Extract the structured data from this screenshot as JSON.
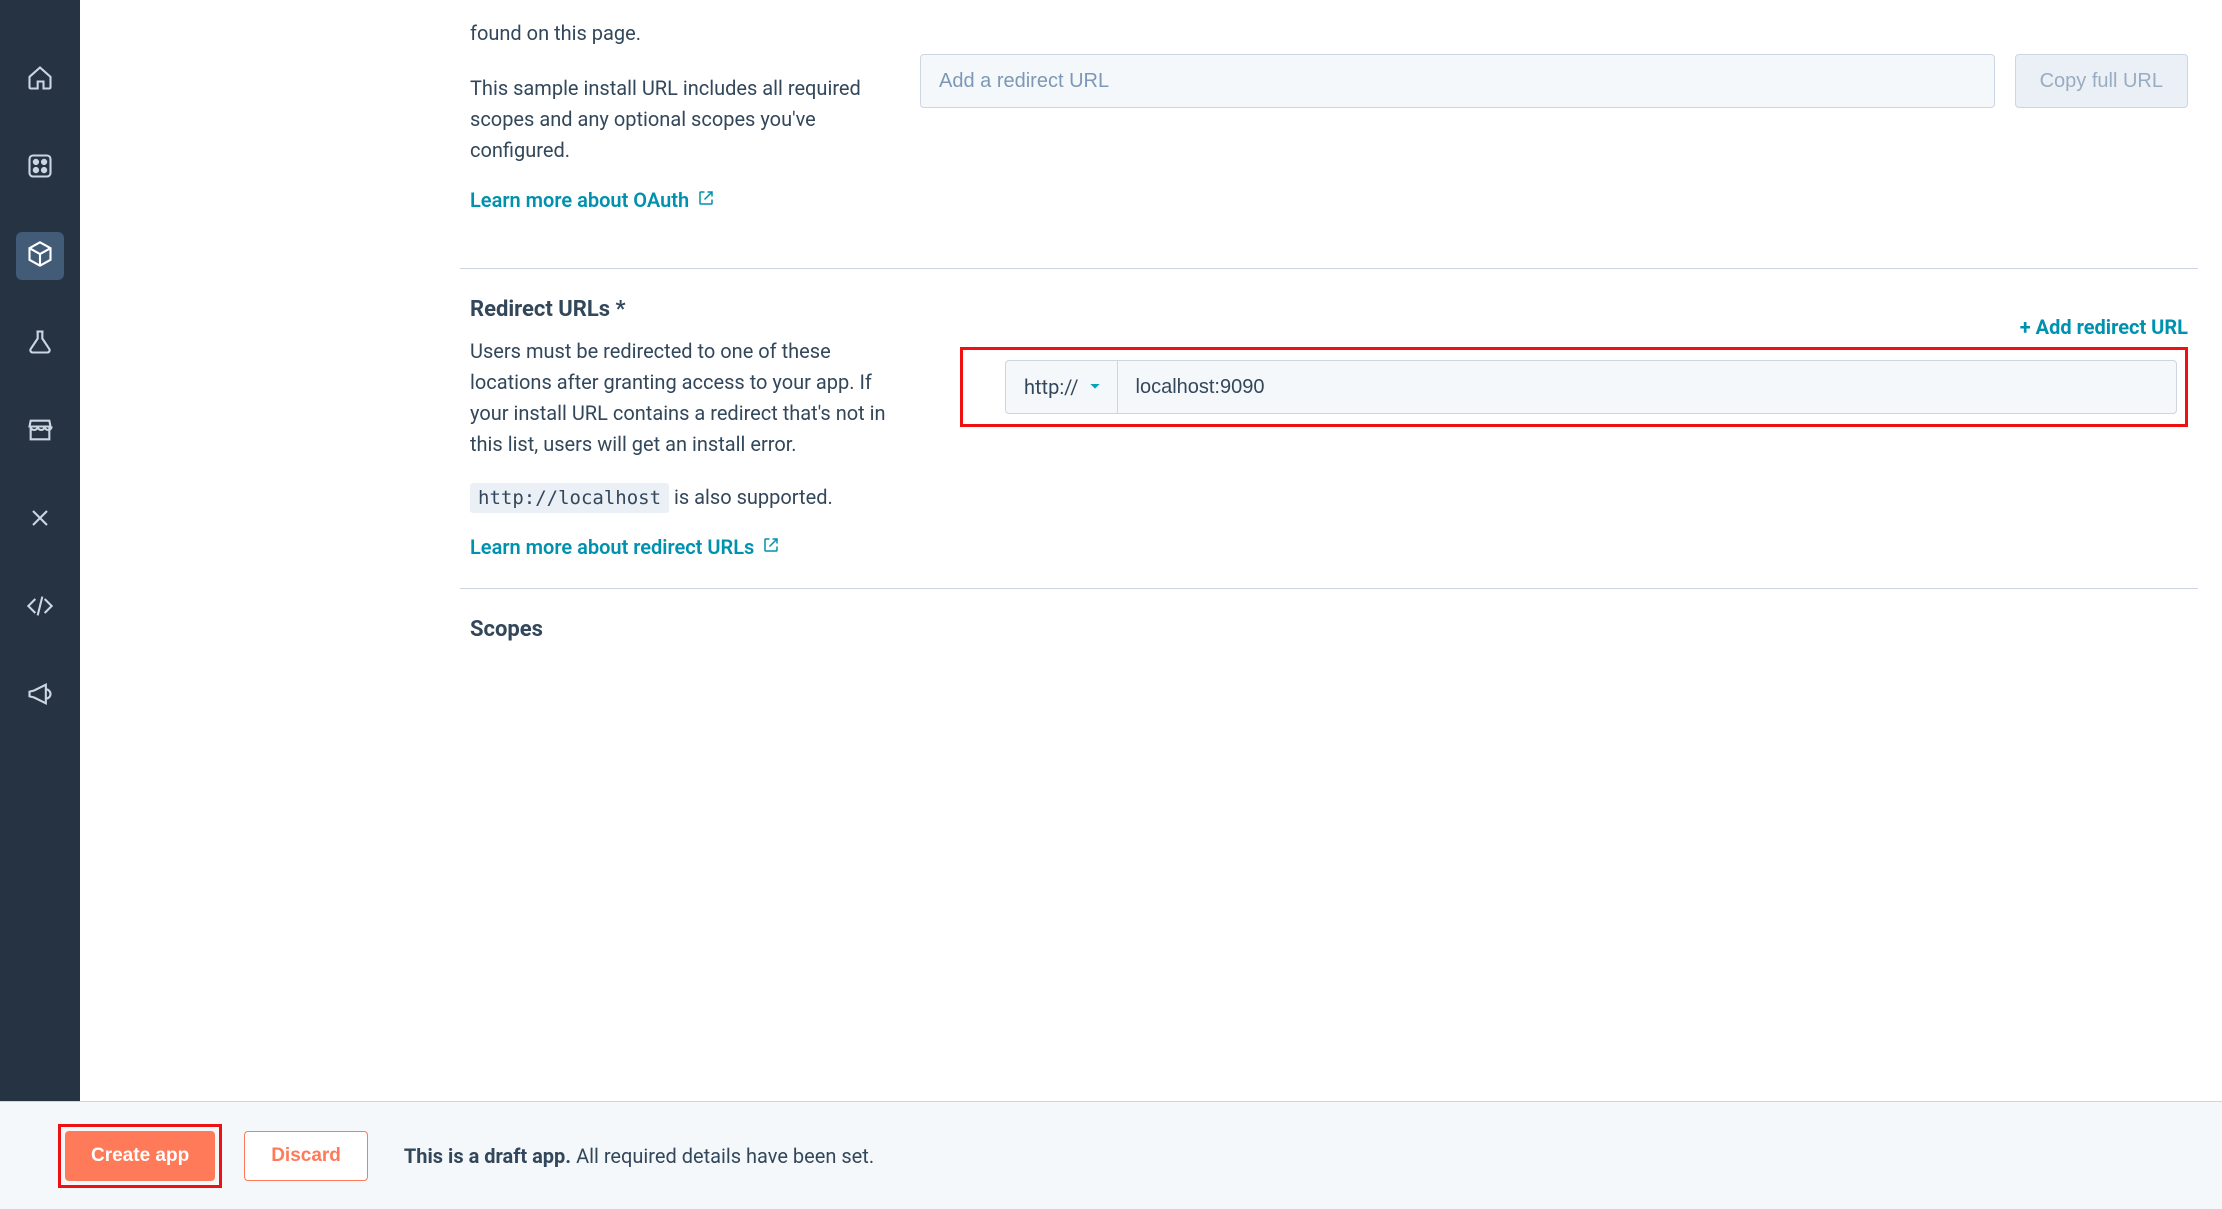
{
  "sidebar": {
    "items": [
      {
        "name": "home"
      },
      {
        "name": "apps"
      },
      {
        "name": "package",
        "active": true
      },
      {
        "name": "flask"
      },
      {
        "name": "store"
      },
      {
        "name": "tools"
      },
      {
        "name": "code"
      },
      {
        "name": "megaphone"
      }
    ]
  },
  "install_section": {
    "body1": "found on this page.",
    "body2": "This sample install URL includes all required scopes and any optional scopes you've configured.",
    "learn_label": "Learn more about OAuth",
    "input_placeholder": "Add a redirect URL",
    "copy_button": "Copy full URL"
  },
  "redirect_section": {
    "title": "Redirect URLs *",
    "body": "Users must be redirected to one of these locations after granting access to your app. If your install URL contains a redirect that's not in this list, users will get an install error.",
    "localhost_code": "http://localhost",
    "localhost_after": " is also supported.",
    "learn_label": "Learn more about redirect URLs",
    "add_link": "+ Add redirect URL",
    "protocol": "http://",
    "url_value": "localhost:9090"
  },
  "scopes_section": {
    "title": "Scopes"
  },
  "footer": {
    "create": "Create app",
    "discard": "Discard",
    "msg_bold": "This is a draft app.",
    "msg_rest": " All required details have been set."
  }
}
